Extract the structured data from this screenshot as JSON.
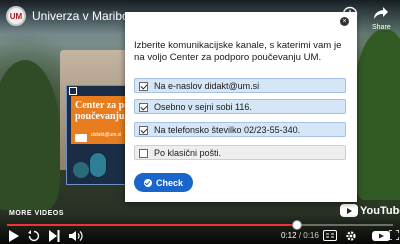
{
  "video": {
    "channel_logo_text": "UM",
    "title": "Univerza v Mariboru (Kra",
    "share_label": "Share",
    "more_videos_label": "MORE VIDEOS",
    "youtube_label": "YouTube",
    "current_time": "0:12",
    "duration": "/ 0:16",
    "progress_fraction": 0.75
  },
  "card": {
    "title_line1": "Center za pod",
    "title_line2": "poučevanju U",
    "subtitle": "didakt@um.si"
  },
  "quiz": {
    "question": "Izberite komunikacijske kanale, s katerimi vam je na voljo Center za podporo poučevanju UM.",
    "options": [
      {
        "label": "Na e-naslov didakt@um.si",
        "checked": true
      },
      {
        "label": "Osebno v sejni sobi 116.",
        "checked": true
      },
      {
        "label": "Na telefonsko številko 02/23-55-340.",
        "checked": true
      },
      {
        "label": "Po klasični pošti.",
        "checked": false
      }
    ],
    "check_label": "Check",
    "close_symbol": "×"
  },
  "colors": {
    "option_checked_bg": "#d5e6f7",
    "option_unchecked_bg": "#eeeeee",
    "check_button": "#1a65c9",
    "progress": "#ee3333"
  },
  "icons": [
    "clock-icon",
    "share-icon",
    "play-icon",
    "replay-icon",
    "next-icon",
    "volume-icon",
    "captions-icon",
    "settings-icon",
    "fullscreen-icon"
  ]
}
